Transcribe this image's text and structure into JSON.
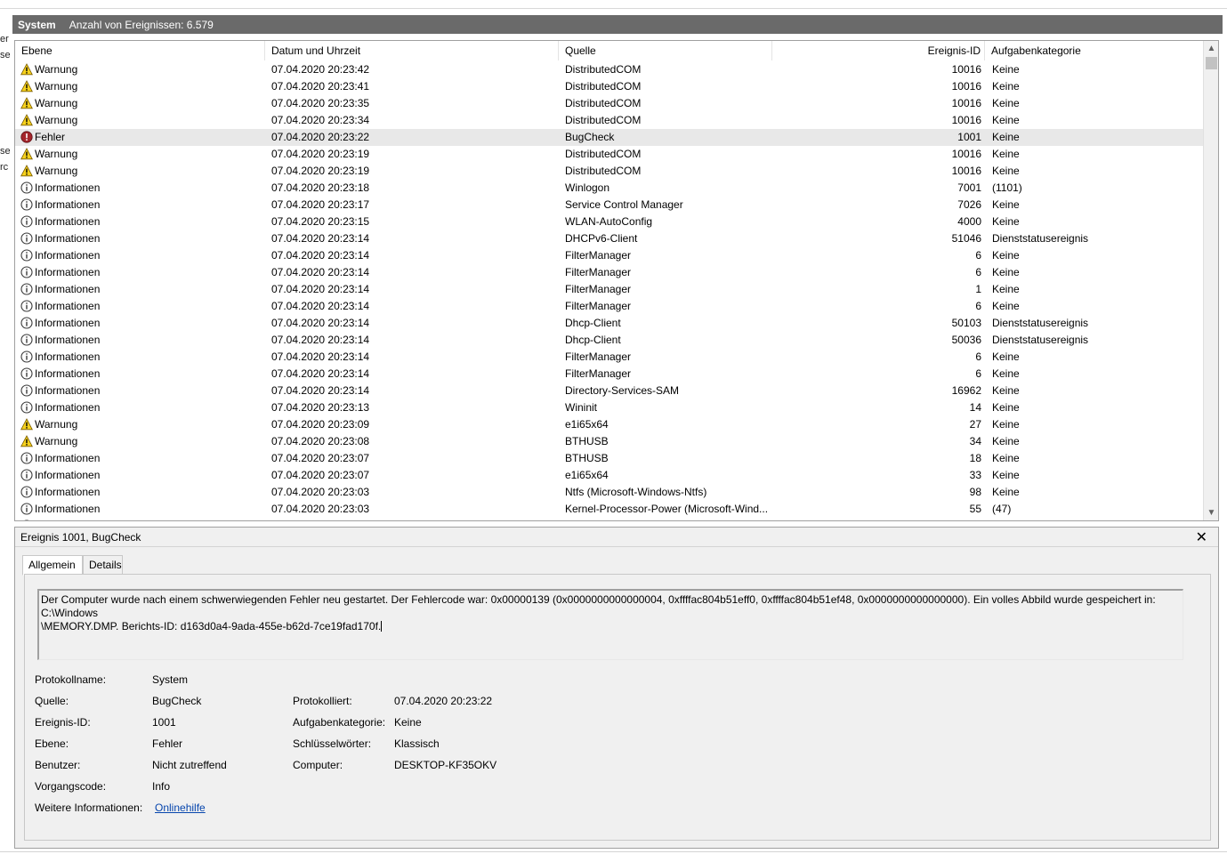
{
  "title": {
    "log_name": "System",
    "count_text": "Anzahl von Ereignissen: 6.579"
  },
  "left_edge_fragments": [
    "er",
    "se",
    "se",
    "rc"
  ],
  "columns": [
    "Ebene",
    "Datum und Uhrzeit",
    "Quelle",
    "Ereignis-ID",
    "Aufgabenkategorie"
  ],
  "rows": [
    {
      "level": "Warnung",
      "icon": "warning-icon",
      "datetime": "07.04.2020 20:23:42",
      "source": "DistributedCOM",
      "id": "10016",
      "category": "Keine"
    },
    {
      "level": "Warnung",
      "icon": "warning-icon",
      "datetime": "07.04.2020 20:23:41",
      "source": "DistributedCOM",
      "id": "10016",
      "category": "Keine"
    },
    {
      "level": "Warnung",
      "icon": "warning-icon",
      "datetime": "07.04.2020 20:23:35",
      "source": "DistributedCOM",
      "id": "10016",
      "category": "Keine"
    },
    {
      "level": "Warnung",
      "icon": "warning-icon",
      "datetime": "07.04.2020 20:23:34",
      "source": "DistributedCOM",
      "id": "10016",
      "category": "Keine"
    },
    {
      "level": "Fehler",
      "icon": "error-icon",
      "datetime": "07.04.2020 20:23:22",
      "source": "BugCheck",
      "id": "1001",
      "category": "Keine",
      "selected": true
    },
    {
      "level": "Warnung",
      "icon": "warning-icon",
      "datetime": "07.04.2020 20:23:19",
      "source": "DistributedCOM",
      "id": "10016",
      "category": "Keine"
    },
    {
      "level": "Warnung",
      "icon": "warning-icon",
      "datetime": "07.04.2020 20:23:19",
      "source": "DistributedCOM",
      "id": "10016",
      "category": "Keine"
    },
    {
      "level": "Informationen",
      "icon": "info-icon",
      "datetime": "07.04.2020 20:23:18",
      "source": "Winlogon",
      "id": "7001",
      "category": "(1101)"
    },
    {
      "level": "Informationen",
      "icon": "info-icon",
      "datetime": "07.04.2020 20:23:17",
      "source": "Service Control Manager",
      "id": "7026",
      "category": "Keine"
    },
    {
      "level": "Informationen",
      "icon": "info-icon",
      "datetime": "07.04.2020 20:23:15",
      "source": "WLAN-AutoConfig",
      "id": "4000",
      "category": "Keine"
    },
    {
      "level": "Informationen",
      "icon": "info-icon",
      "datetime": "07.04.2020 20:23:14",
      "source": "DHCPv6-Client",
      "id": "51046",
      "category": "Dienststatusereignis"
    },
    {
      "level": "Informationen",
      "icon": "info-icon",
      "datetime": "07.04.2020 20:23:14",
      "source": "FilterManager",
      "id": "6",
      "category": "Keine"
    },
    {
      "level": "Informationen",
      "icon": "info-icon",
      "datetime": "07.04.2020 20:23:14",
      "source": "FilterManager",
      "id": "6",
      "category": "Keine"
    },
    {
      "level": "Informationen",
      "icon": "info-icon",
      "datetime": "07.04.2020 20:23:14",
      "source": "FilterManager",
      "id": "1",
      "category": "Keine"
    },
    {
      "level": "Informationen",
      "icon": "info-icon",
      "datetime": "07.04.2020 20:23:14",
      "source": "FilterManager",
      "id": "6",
      "category": "Keine"
    },
    {
      "level": "Informationen",
      "icon": "info-icon",
      "datetime": "07.04.2020 20:23:14",
      "source": "Dhcp-Client",
      "id": "50103",
      "category": "Dienststatusereignis"
    },
    {
      "level": "Informationen",
      "icon": "info-icon",
      "datetime": "07.04.2020 20:23:14",
      "source": "Dhcp-Client",
      "id": "50036",
      "category": "Dienststatusereignis"
    },
    {
      "level": "Informationen",
      "icon": "info-icon",
      "datetime": "07.04.2020 20:23:14",
      "source": "FilterManager",
      "id": "6",
      "category": "Keine"
    },
    {
      "level": "Informationen",
      "icon": "info-icon",
      "datetime": "07.04.2020 20:23:14",
      "source": "FilterManager",
      "id": "6",
      "category": "Keine"
    },
    {
      "level": "Informationen",
      "icon": "info-icon",
      "datetime": "07.04.2020 20:23:14",
      "source": "Directory-Services-SAM",
      "id": "16962",
      "category": "Keine"
    },
    {
      "level": "Informationen",
      "icon": "info-icon",
      "datetime": "07.04.2020 20:23:13",
      "source": "Wininit",
      "id": "14",
      "category": "Keine"
    },
    {
      "level": "Warnung",
      "icon": "warning-icon",
      "datetime": "07.04.2020 20:23:09",
      "source": "e1i65x64",
      "id": "27",
      "category": "Keine"
    },
    {
      "level": "Warnung",
      "icon": "warning-icon",
      "datetime": "07.04.2020 20:23:08",
      "source": "BTHUSB",
      "id": "34",
      "category": "Keine"
    },
    {
      "level": "Informationen",
      "icon": "info-icon",
      "datetime": "07.04.2020 20:23:07",
      "source": "BTHUSB",
      "id": "18",
      "category": "Keine"
    },
    {
      "level": "Informationen",
      "icon": "info-icon",
      "datetime": "07.04.2020 20:23:07",
      "source": "e1i65x64",
      "id": "33",
      "category": "Keine"
    },
    {
      "level": "Informationen",
      "icon": "info-icon",
      "datetime": "07.04.2020 20:23:03",
      "source": "Ntfs (Microsoft-Windows-Ntfs)",
      "id": "98",
      "category": "Keine"
    },
    {
      "level": "Informationen",
      "icon": "info-icon",
      "datetime": "07.04.2020 20:23:03",
      "source": "Kernel-Processor-Power (Microsoft-Wind...",
      "id": "55",
      "category": "(47)"
    },
    {
      "level": "Informationen",
      "icon": "info-icon",
      "datetime": "",
      "source": "",
      "id": "",
      "category": ""
    }
  ],
  "detail": {
    "title": "Ereignis 1001, BugCheck",
    "close_glyph": "✕",
    "tabs": [
      "Allgemein",
      "Details"
    ],
    "message_line1": "Der Computer wurde nach einem schwerwiegenden Fehler neu gestartet. Der Fehlercode war: 0x00000139 (0x0000000000000004, 0xffffac804b51eff0, 0xffffac804b51ef48, 0x0000000000000000). Ein volles Abbild wurde gespeichert in: C:\\Windows",
    "message_line2": "\\MEMORY.DMP. Berichts-ID: d163d0a4-9ada-455e-b62d-7ce19fad170f.",
    "props_left": [
      {
        "label": "Protokollname:",
        "value": "System"
      },
      {
        "label": "Quelle:",
        "value": "BugCheck"
      },
      {
        "label": "Ereignis-ID:",
        "value": "1001"
      },
      {
        "label": "Ebene:",
        "value": "Fehler"
      },
      {
        "label": "Benutzer:",
        "value": "Nicht zutreffend"
      },
      {
        "label": "Vorgangscode:",
        "value": "Info"
      },
      {
        "label": "Weitere Informationen:",
        "value": "Onlinehilfe"
      }
    ],
    "props_right": [
      {
        "label": "Protokolliert:",
        "value": "07.04.2020 20:23:22"
      },
      {
        "label": "Aufgabenkategorie:",
        "value": "Keine"
      },
      {
        "label": "Schlüsselwörter:",
        "value": "Klassisch"
      },
      {
        "label": "Computer:",
        "value": "DESKTOP-KF35OKV"
      }
    ]
  },
  "colors": {
    "titlebar": "#6a6a6a",
    "selected_row": "#e8e8e8",
    "warning": "#f7d21c",
    "error": "#a4262c",
    "info": "#3a3a3a",
    "link": "#0645ad"
  }
}
